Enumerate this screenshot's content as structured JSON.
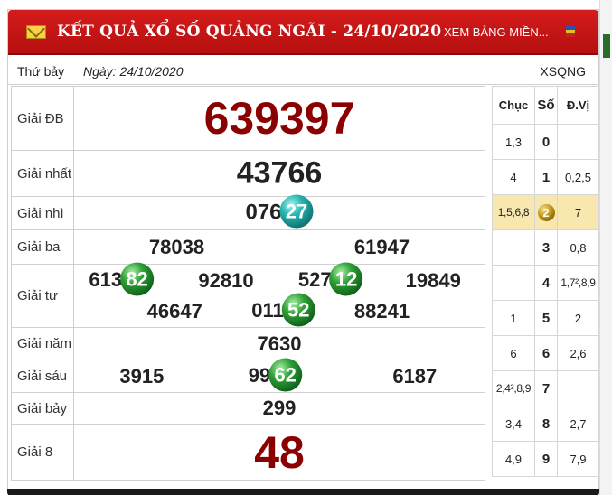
{
  "header": {
    "title": "KẾT QUẢ XỔ SỐ QUẢNG NGÃI - 24/10/2020",
    "link": "XEM BẢNG MIỀN...",
    "colors": {
      "header_red": "#c61616",
      "special_prize": "#8b0000",
      "highlight_row": "#f9e7b0"
    }
  },
  "info": {
    "day": "Thứ bảy",
    "date": "Ngày: 24/10/2020",
    "code": "XSQNG"
  },
  "prizes": [
    {
      "label": "Giải ĐB",
      "numbers": [
        {
          "main": "639397",
          "ball": ""
        }
      ]
    },
    {
      "label": "Giải nhất",
      "numbers": [
        {
          "main": "43766",
          "ball": ""
        }
      ]
    },
    {
      "label": "Giải nhì",
      "numbers": [
        {
          "main": "076",
          "ball": "27"
        }
      ]
    },
    {
      "label": "Giải ba",
      "numbers": [
        {
          "main": "78038",
          "ball": ""
        },
        {
          "main": "61947",
          "ball": ""
        }
      ]
    },
    {
      "label": "Giải tư",
      "numbers": [
        {
          "main": "613",
          "ball": "82"
        },
        {
          "main": "92810",
          "ball": ""
        },
        {
          "main": "527",
          "ball": "12"
        },
        {
          "main": "19849",
          "ball": ""
        },
        {
          "main": "46647",
          "ball": ""
        },
        {
          "main": "011",
          "ball": "52"
        },
        {
          "main": "88241",
          "ball": ""
        }
      ]
    },
    {
      "label": "Giải năm",
      "numbers": [
        {
          "main": "7630",
          "ball": ""
        }
      ]
    },
    {
      "label": "Giải sáu",
      "numbers": [
        {
          "main": "3915",
          "ball": ""
        },
        {
          "main": "99",
          "ball": "62"
        },
        {
          "main": "6187",
          "ball": ""
        }
      ]
    },
    {
      "label": "Giải bảy",
      "numbers": [
        {
          "main": "299",
          "ball": ""
        }
      ]
    },
    {
      "label": "Giải 8",
      "numbers": [
        {
          "main": "48",
          "ball": ""
        }
      ]
    }
  ],
  "loto": {
    "headers": {
      "chuc": "Chục",
      "so": "Số",
      "dvi": "Đ.Vị"
    },
    "rows": [
      {
        "chuc": "1,3",
        "so": "0",
        "dvi": ""
      },
      {
        "chuc": "4",
        "so": "1",
        "dvi": "0,2,5"
      },
      {
        "chuc": "1,5,6,8",
        "so": "2",
        "dvi": "7"
      },
      {
        "chuc": "",
        "so": "3",
        "dvi": "0,8"
      },
      {
        "chuc": "",
        "so": "4",
        "dvi": "1,7²,8,9"
      },
      {
        "chuc": "1",
        "so": "5",
        "dvi": "2"
      },
      {
        "chuc": "6",
        "so": "6",
        "dvi": "2,6"
      },
      {
        "chuc": "2,4²,8,9",
        "so": "7",
        "dvi": ""
      },
      {
        "chuc": "3,4",
        "so": "8",
        "dvi": "2,7"
      },
      {
        "chuc": "4,9",
        "so": "9",
        "dvi": "7,9"
      }
    ]
  }
}
